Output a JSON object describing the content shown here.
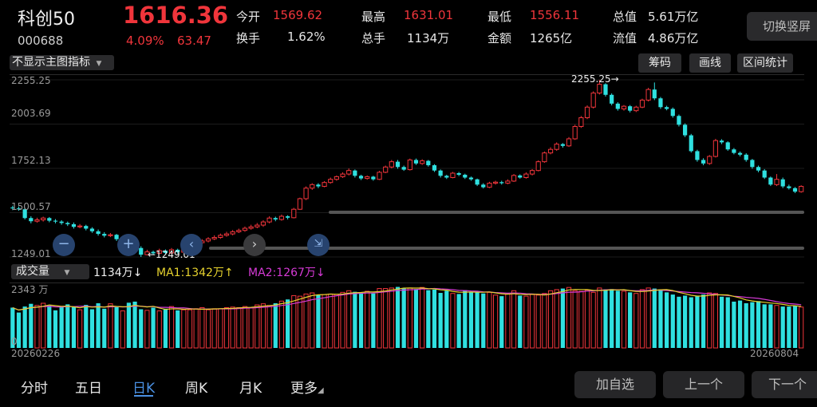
{
  "stock": {
    "name": "科创50",
    "code": "000688",
    "price": "1616.36",
    "change_pct": "4.09%",
    "change_abs": "63.47"
  },
  "stats": {
    "open_label": "今开",
    "open": "1569.62",
    "high_label": "最高",
    "high": "1631.01",
    "low_label": "最低",
    "low": "1556.11",
    "total_value_label": "总值",
    "total_value": "5.61万亿",
    "turnover_label": "换手",
    "turnover": "1.62%",
    "volume_label": "总手",
    "volume": "1134万",
    "amount_label": "金额",
    "amount": "1265亿",
    "float_value_label": "流值",
    "float_value": "4.86万亿"
  },
  "switch_button": "切换竖屏",
  "indicator_select": "不显示主图指标",
  "toolbar": {
    "chips": "筹码",
    "draw": "画线",
    "range_stats": "区间统计"
  },
  "price_axis": [
    "2255.25",
    "2003.69",
    "1752.13",
    "1500.57",
    "1249.01"
  ],
  "annotations": {
    "max": "2255.25→",
    "min": "←1249.01"
  },
  "volume_panel": {
    "select": "成交量",
    "current": "1134万↓",
    "ma1": "MA1:1342万↑",
    "ma2": "MA2:1267万↓",
    "axis_top": "2343 万",
    "axis_bottom": "0"
  },
  "dates": {
    "start": "20260226",
    "end": "20260804"
  },
  "tabs": [
    "分时",
    "五日",
    "日K",
    "周K",
    "月K",
    "更多"
  ],
  "actions": {
    "add_watch": "加自选",
    "prev": "上一个",
    "next": "下一个"
  },
  "colors": {
    "up": "#f0353b",
    "down": "#2fe0e0",
    "ma1": "#e6d22e",
    "ma2": "#d63ad6",
    "bg": "#000000"
  },
  "chart_data": {
    "type": "candlestick",
    "y_axis_ticks": [
      2255.25,
      2003.69,
      1752.13,
      1500.57,
      1249.01
    ],
    "ylim": [
      1249.01,
      2255.25
    ],
    "x_range": [
      "20260226",
      "20260804"
    ],
    "candles": [
      [
        1530,
        1525,
        1540,
        1515
      ],
      [
        1525,
        1520,
        1535,
        1512
      ],
      [
        1520,
        1470,
        1528,
        1462
      ],
      [
        1470,
        1452,
        1480,
        1440
      ],
      [
        1452,
        1460,
        1472,
        1444
      ],
      [
        1460,
        1470,
        1478,
        1450
      ],
      [
        1470,
        1455,
        1476,
        1446
      ],
      [
        1455,
        1450,
        1464,
        1440
      ],
      [
        1450,
        1442,
        1458,
        1432
      ],
      [
        1442,
        1435,
        1450,
        1425
      ],
      [
        1435,
        1420,
        1445,
        1410
      ],
      [
        1420,
        1425,
        1436,
        1412
      ],
      [
        1425,
        1410,
        1432,
        1400
      ],
      [
        1410,
        1395,
        1418,
        1386
      ],
      [
        1395,
        1380,
        1405,
        1370
      ],
      [
        1380,
        1370,
        1390,
        1360
      ],
      [
        1370,
        1375,
        1385,
        1362
      ],
      [
        1375,
        1350,
        1380,
        1340
      ],
      [
        1350,
        1355,
        1365,
        1342
      ],
      [
        1355,
        1335,
        1360,
        1325
      ],
      [
        1335,
        1300,
        1340,
        1292
      ],
      [
        1300,
        1262,
        1310,
        1249
      ],
      [
        1262,
        1278,
        1290,
        1258
      ],
      [
        1278,
        1270,
        1285,
        1262
      ],
      [
        1270,
        1285,
        1296,
        1264
      ],
      [
        1285,
        1272,
        1292,
        1265
      ],
      [
        1272,
        1290,
        1300,
        1266
      ],
      [
        1290,
        1276,
        1296,
        1268
      ],
      [
        1276,
        1300,
        1310,
        1270
      ],
      [
        1300,
        1318,
        1326,
        1294
      ],
      [
        1318,
        1330,
        1340,
        1310
      ],
      [
        1330,
        1340,
        1350,
        1322
      ],
      [
        1340,
        1352,
        1362,
        1332
      ],
      [
        1352,
        1360,
        1372,
        1345
      ],
      [
        1360,
        1372,
        1382,
        1352
      ],
      [
        1372,
        1380,
        1392,
        1364
      ],
      [
        1380,
        1392,
        1402,
        1372
      ],
      [
        1392,
        1400,
        1410,
        1385
      ],
      [
        1400,
        1412,
        1422,
        1392
      ],
      [
        1412,
        1420,
        1432,
        1404
      ],
      [
        1420,
        1430,
        1442,
        1412
      ],
      [
        1430,
        1448,
        1458,
        1420
      ],
      [
        1448,
        1470,
        1480,
        1440
      ],
      [
        1470,
        1462,
        1478,
        1452
      ],
      [
        1462,
        1480,
        1490,
        1455
      ],
      [
        1480,
        1472,
        1486,
        1462
      ],
      [
        1472,
        1520,
        1528,
        1468
      ],
      [
        1520,
        1580,
        1586,
        1516
      ],
      [
        1580,
        1640,
        1650,
        1572
      ],
      [
        1640,
        1660,
        1668,
        1630
      ],
      [
        1660,
        1650,
        1668,
        1640
      ],
      [
        1650,
        1672,
        1680,
        1645
      ],
      [
        1672,
        1690,
        1700,
        1665
      ],
      [
        1690,
        1705,
        1712,
        1682
      ],
      [
        1705,
        1720,
        1730,
        1698
      ],
      [
        1720,
        1740,
        1752,
        1712
      ],
      [
        1740,
        1710,
        1746,
        1700
      ],
      [
        1710,
        1695,
        1716,
        1686
      ],
      [
        1695,
        1705,
        1712,
        1688
      ],
      [
        1705,
        1690,
        1710,
        1682
      ],
      [
        1690,
        1730,
        1738,
        1686
      ],
      [
        1730,
        1760,
        1768,
        1725
      ],
      [
        1760,
        1790,
        1800,
        1752
      ],
      [
        1790,
        1760,
        1800,
        1750
      ],
      [
        1760,
        1745,
        1768,
        1738
      ],
      [
        1745,
        1800,
        1808,
        1740
      ],
      [
        1800,
        1780,
        1808,
        1772
      ],
      [
        1780,
        1795,
        1804,
        1772
      ],
      [
        1795,
        1770,
        1800,
        1762
      ],
      [
        1770,
        1740,
        1776,
        1732
      ],
      [
        1740,
        1710,
        1746,
        1700
      ],
      [
        1710,
        1700,
        1716,
        1692
      ],
      [
        1700,
        1725,
        1732,
        1696
      ],
      [
        1725,
        1716,
        1732,
        1708
      ],
      [
        1716,
        1700,
        1722,
        1692
      ],
      [
        1700,
        1690,
        1706,
        1682
      ],
      [
        1690,
        1660,
        1694,
        1652
      ],
      [
        1660,
        1645,
        1668,
        1638
      ],
      [
        1645,
        1668,
        1676,
        1640
      ],
      [
        1668,
        1674,
        1682,
        1660
      ],
      [
        1674,
        1668,
        1682,
        1660
      ],
      [
        1668,
        1680,
        1690,
        1662
      ],
      [
        1680,
        1712,
        1720,
        1675
      ],
      [
        1712,
        1700,
        1718,
        1694
      ],
      [
        1700,
        1720,
        1730,
        1694
      ],
      [
        1720,
        1740,
        1748,
        1712
      ],
      [
        1740,
        1790,
        1798,
        1735
      ],
      [
        1790,
        1840,
        1848,
        1784
      ],
      [
        1840,
        1860,
        1872,
        1832
      ],
      [
        1860,
        1890,
        1900,
        1852
      ],
      [
        1890,
        1880,
        1896,
        1870
      ],
      [
        1880,
        1920,
        1930,
        1874
      ],
      [
        1920,
        1990,
        2000,
        1914
      ],
      [
        1990,
        2040,
        2050,
        1982
      ],
      [
        2040,
        2100,
        2110,
        2032
      ],
      [
        2100,
        2180,
        2190,
        2092
      ],
      [
        2180,
        2230,
        2255,
        2172
      ],
      [
        2230,
        2170,
        2236,
        2160
      ],
      [
        2170,
        2120,
        2178,
        2110
      ],
      [
        2120,
        2090,
        2128,
        2080
      ],
      [
        2090,
        2105,
        2112,
        2080
      ],
      [
        2105,
        2080,
        2112,
        2070
      ],
      [
        2080,
        2100,
        2108,
        2072
      ],
      [
        2100,
        2140,
        2148,
        2094
      ],
      [
        2140,
        2200,
        2210,
        2132
      ],
      [
        2200,
        2150,
        2240,
        2140
      ],
      [
        2150,
        2100,
        2158,
        2090
      ],
      [
        2100,
        2090,
        2108,
        2082
      ],
      [
        2090,
        2050,
        2098,
        2040
      ],
      [
        2050,
        2000,
        2058,
        1990
      ],
      [
        2000,
        1940,
        2008,
        1930
      ],
      [
        1940,
        1850,
        1948,
        1842
      ],
      [
        1850,
        1800,
        1858,
        1790
      ],
      [
        1800,
        1780,
        1810,
        1770
      ],
      [
        1780,
        1820,
        1828,
        1772
      ],
      [
        1820,
        1910,
        1920,
        1814
      ],
      [
        1910,
        1900,
        1918,
        1890
      ],
      [
        1900,
        1860,
        1906,
        1852
      ],
      [
        1860,
        1840,
        1868,
        1832
      ],
      [
        1840,
        1830,
        1848,
        1820
      ],
      [
        1830,
        1800,
        1838,
        1790
      ],
      [
        1800,
        1760,
        1806,
        1750
      ],
      [
        1760,
        1740,
        1768,
        1730
      ],
      [
        1740,
        1700,
        1748,
        1692
      ],
      [
        1700,
        1660,
        1706,
        1652
      ],
      [
        1660,
        1690,
        1720,
        1652
      ],
      [
        1690,
        1650,
        1700,
        1640
      ],
      [
        1650,
        1640,
        1660,
        1632
      ],
      [
        1640,
        1620,
        1646,
        1612
      ],
      [
        1620,
        1650,
        1656,
        1614
      ]
    ],
    "volume": [
      1480,
      1300,
      1520,
      1620,
      1560,
      1640,
      1560,
      1380,
      1500,
      1600,
      1500,
      1400,
      1580,
      1420,
      1640,
      1440,
      1620,
      1500,
      1360,
      1660,
      1700,
      1420,
      1380,
      1480,
      1360,
      1440,
      1520,
      1380,
      1400,
      1400,
      1440,
      1480,
      1400,
      1440,
      1440,
      1480,
      1500,
      1480,
      1520,
      1480,
      1580,
      1620,
      1560,
      1640,
      1720,
      1780,
      1920,
      1900,
      1980,
      2020,
      1940,
      1960,
      1980,
      1960,
      2040,
      2100,
      2060,
      2020,
      2080,
      2000,
      2180,
      2180,
      2200,
      2240,
      2180,
      2200,
      2160,
      2220,
      2120,
      2140,
      2020,
      2100,
      2000,
      1980,
      2120,
      2060,
      2060,
      2000,
      2040,
      1940,
      1900,
      1980,
      2100,
      1920,
      1900,
      1960,
      1940,
      2000,
      2100,
      2140,
      2180,
      2220,
      2100,
      2080,
      2120,
      2040,
      2200,
      2150,
      2160,
      2100,
      2080,
      2040,
      2000,
      2140,
      2200,
      2180,
      2150,
      2040,
      1960,
      1880,
      1920,
      1860,
      1900,
      1960,
      2020,
      2000,
      1880,
      1860,
      1700,
      1740,
      1640,
      1680,
      1720,
      1600,
      1600,
      1560,
      1520,
      1520,
      1540,
      1500
    ]
  }
}
